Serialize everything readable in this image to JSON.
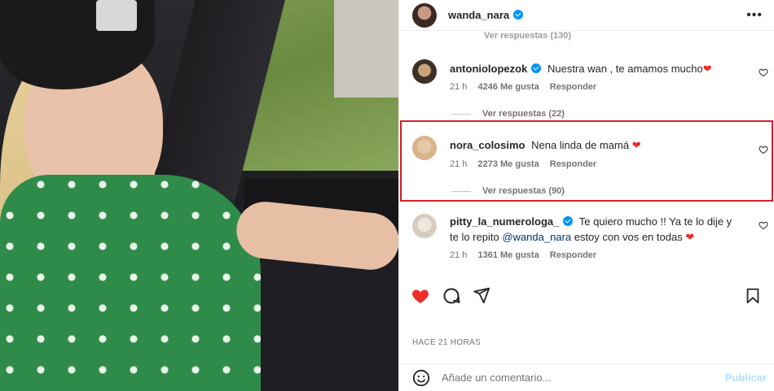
{
  "header": {
    "username": "wanda_nara",
    "verified": true,
    "more_icon": "more-horizontal-icon"
  },
  "peek_replies": "Ver respuestas (130)",
  "comments": [
    {
      "username": "antoniolopezok",
      "verified": true,
      "text": "Nuestra wan , te amamos mucho",
      "emoji": "❤",
      "time": "21 h",
      "likes": "4246 Me gusta",
      "reply": "Responder",
      "replies": "Ver respuestas (22)"
    },
    {
      "username": "nora_colosimo",
      "verified": false,
      "text": "Nena linda de mamá",
      "emoji": "❤",
      "time": "21 h",
      "likes": "2273 Me gusta",
      "reply": "Responder",
      "replies": "Ver respuestas (90)"
    },
    {
      "username": "pitty_la_numerologa_",
      "verified": true,
      "text_before": "Te quiero mucho !! Ya te lo dije y te lo repito",
      "mention": "@wanda_nara",
      "text_after": "estoy con vos en todas",
      "emoji": "❤",
      "time": "21 h",
      "likes": "1361 Me gusta",
      "reply": "Responder"
    }
  ],
  "actions": {
    "like": "heart-filled-icon",
    "comment": "comment-icon",
    "share": "send-icon",
    "save": "bookmark-icon"
  },
  "timestamp": "HACE 21 HORAS",
  "add_comment": {
    "emoji_icon": "smiley-icon",
    "placeholder": "Añade un comentario...",
    "publish": "Publicar"
  },
  "colors": {
    "heart": "#ed2c2c",
    "verified": "#0095f6",
    "highlight": "#d0202a",
    "publish": "#b2dffc"
  }
}
